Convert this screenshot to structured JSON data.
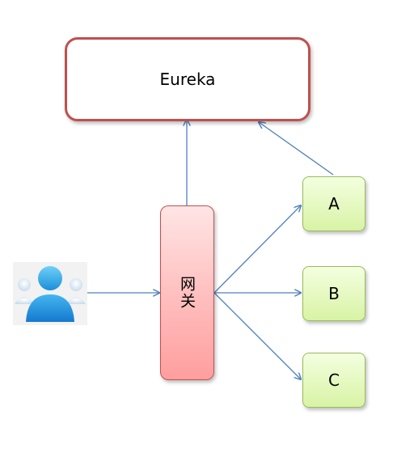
{
  "eureka": {
    "label": "Eureka"
  },
  "gateway": {
    "label": "网关"
  },
  "services": [
    {
      "label": "A"
    },
    {
      "label": "B"
    },
    {
      "label": "C"
    }
  ],
  "client": {
    "icon": "user-group-icon"
  },
  "colors": {
    "eureka_border": "#c0504d",
    "gateway_fill": "#ffc0c0",
    "service_fill": "#d8f3a5",
    "service_border": "#9bbb59",
    "arrow": "#4f81bd",
    "user_icon": "#1e9be2"
  }
}
